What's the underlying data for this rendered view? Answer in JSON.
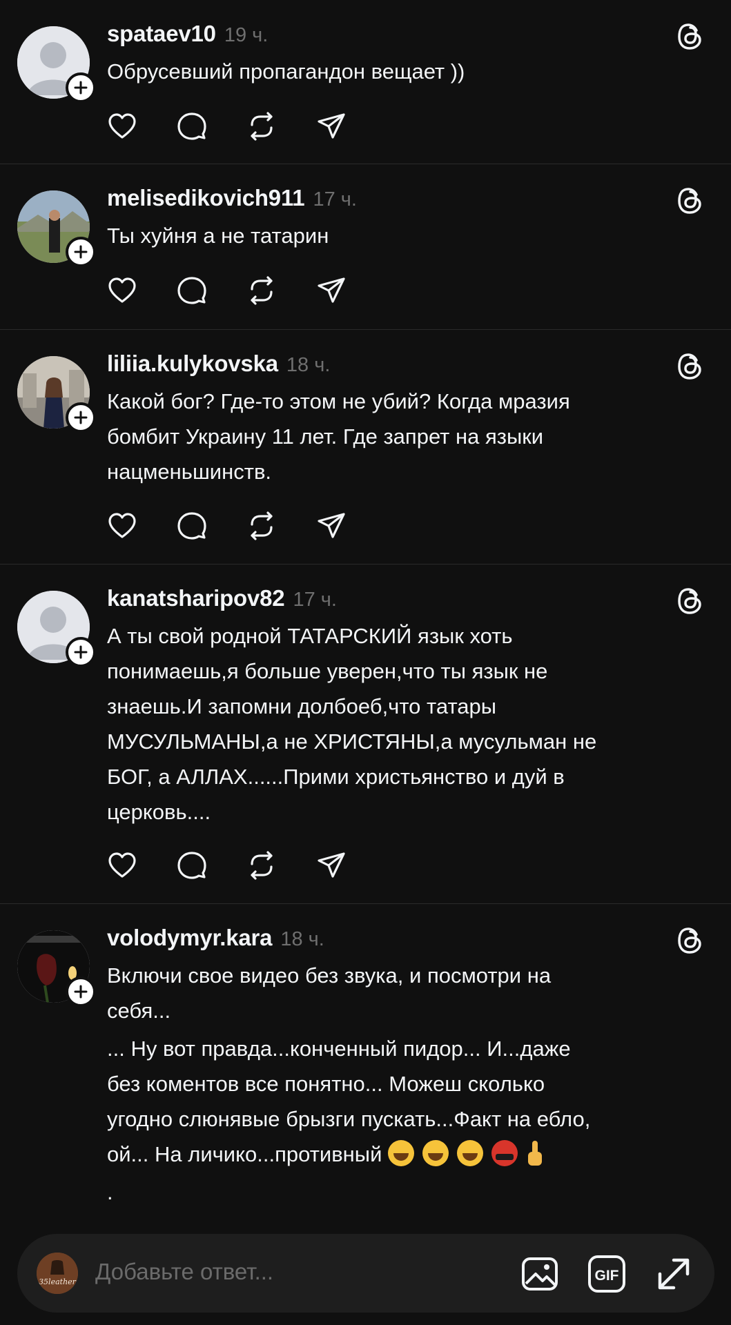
{
  "colors": {
    "background": "#101010",
    "text": "#f3f5f7",
    "muted": "#6f6f6f",
    "divider": "#2a2a2a",
    "input_bg": "#1e1e1e"
  },
  "posts": [
    {
      "username": "spataev10",
      "time": "19 ч.",
      "paragraphs": [
        "Обрусевший пропагандон вещает ))"
      ],
      "avatar": "default-avatar"
    },
    {
      "username": "melisedikovich911",
      "time": "17 ч.",
      "paragraphs": [
        "Ты хуйня а не татарин"
      ],
      "avatar": "photo-avatar"
    },
    {
      "username": "liliia.kulykovska",
      "time": "18 ч.",
      "paragraphs": [
        "Какой бог? Где-то этом не убий? Когда мразия\nбомбит Украину 11 лет. Где запрет на языки\nнацменьшинств."
      ],
      "avatar": "photo-avatar"
    },
    {
      "username": "kanatsharipov82",
      "time": "17 ч.",
      "paragraphs": [
        "А ты свой родной ТАТАРСКИЙ язык хоть\nпонимаешь,я больше уверен,что ты язык не\nзнаешь.И запомни долбоеб,что татары\nМУСУЛЬМАНЫ,а не ХРИСТЯНЫ,а мусульман не\nБОГ, а АЛЛАХ......Прими христьянство и дуй в\nцерковь...."
      ],
      "avatar": "default-avatar"
    },
    {
      "username": "volodymyr.kara",
      "time": "18 ч.",
      "paragraphs": [
        "Включи свое видео без звука, и посмотри на\nсебя...",
        "... Ну вот правда...конченный пидор... И...даже\nбез коментов все понятно... Можеш сколько\nугодно слюнявые брызги пускать...Факт на ебло,\nой... На личико...противный ",
        "."
      ],
      "emojis": [
        "grinning-squinting-face",
        "grinning-squinting-face",
        "grinning-squinting-face",
        "face-with-symbols-on-mouth",
        "middle-finger"
      ],
      "avatar": "photo-avatar"
    }
  ],
  "reply_bar": {
    "placeholder": "Добавьте ответ...",
    "avatar_label": "35leather",
    "icons": [
      "image-icon",
      "gif-icon",
      "expand-icon"
    ]
  },
  "action_icons": [
    "heart-icon",
    "comment-icon",
    "repost-icon",
    "share-icon"
  ]
}
